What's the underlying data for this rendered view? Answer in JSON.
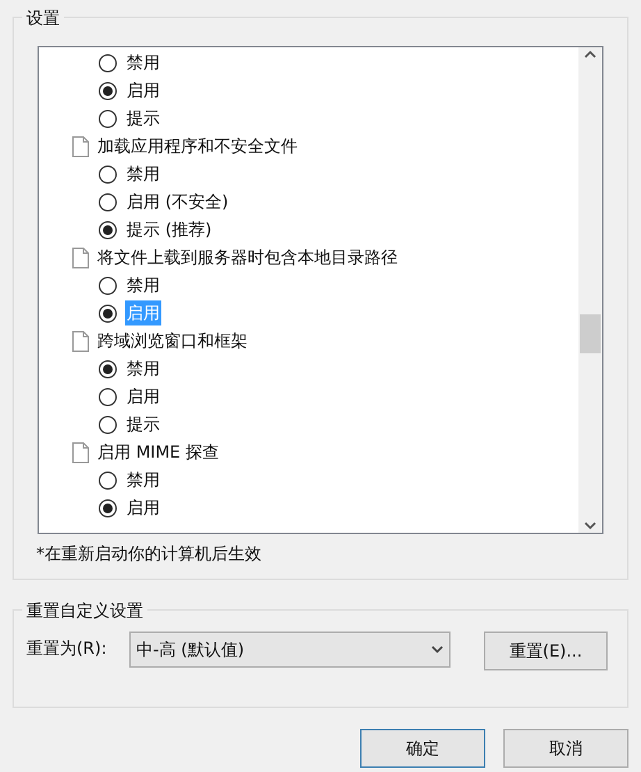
{
  "settings_group": {
    "title": "设置",
    "items": [
      {
        "kind": "option",
        "label": "禁用",
        "selected": false,
        "focused": false
      },
      {
        "kind": "option",
        "label": "启用",
        "selected": true,
        "focused": false
      },
      {
        "kind": "option",
        "label": "提示",
        "selected": false,
        "focused": false
      },
      {
        "kind": "setting",
        "label": "加载应用程序和不安全文件"
      },
      {
        "kind": "option",
        "label": "禁用",
        "selected": false,
        "focused": false
      },
      {
        "kind": "option",
        "label": "启用 (不安全)",
        "selected": false,
        "focused": false
      },
      {
        "kind": "option",
        "label": "提示 (推荐)",
        "selected": true,
        "focused": false
      },
      {
        "kind": "setting",
        "label": "将文件上载到服务器时包含本地目录路径"
      },
      {
        "kind": "option",
        "label": "禁用",
        "selected": false,
        "focused": false
      },
      {
        "kind": "option",
        "label": "启用",
        "selected": true,
        "focused": true
      },
      {
        "kind": "setting",
        "label": "跨域浏览窗口和框架"
      },
      {
        "kind": "option",
        "label": "禁用",
        "selected": true,
        "focused": false
      },
      {
        "kind": "option",
        "label": "启用",
        "selected": false,
        "focused": false
      },
      {
        "kind": "option",
        "label": "提示",
        "selected": false,
        "focused": false
      },
      {
        "kind": "setting",
        "label": "启用 MIME 探查"
      },
      {
        "kind": "option",
        "label": "禁用",
        "selected": false,
        "focused": false
      },
      {
        "kind": "option",
        "label": "启用",
        "selected": true,
        "focused": false
      }
    ],
    "note": "*在重新启动你的计算机后生效"
  },
  "reset_group": {
    "title": "重置自定义设置",
    "label": "重置为(R):",
    "dropdown_value": "中-高 (默认值)",
    "button": "重置(E)..."
  },
  "buttons": [
    "确定",
    "取消"
  ]
}
